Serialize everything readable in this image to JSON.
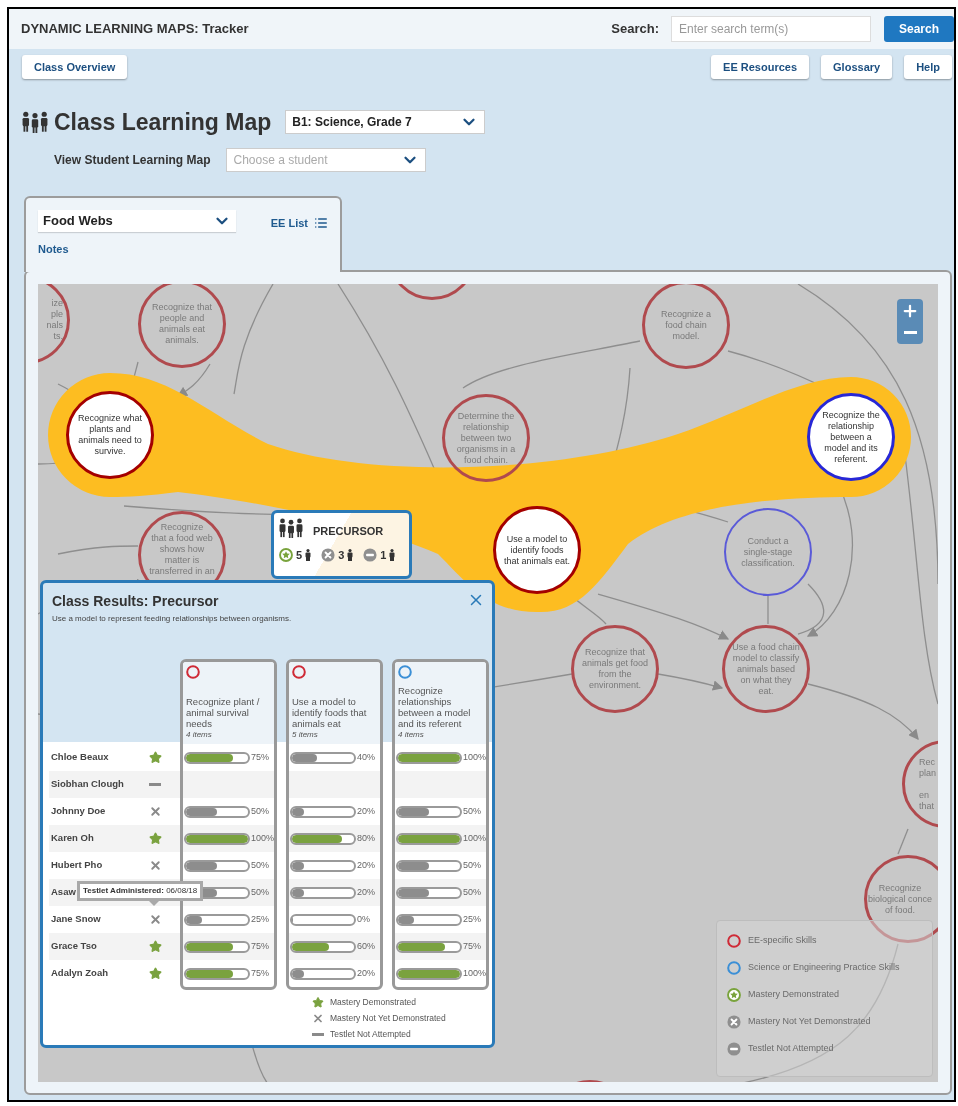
{
  "app": {
    "title": "DYNAMIC LEARNING MAPS: Tracker"
  },
  "search": {
    "label": "Search:",
    "placeholder": "Enter search term(s)",
    "button": "Search"
  },
  "nav_left": [
    "Class Overview"
  ],
  "nav_right": [
    "EE Resources",
    "Glossary",
    "Help"
  ],
  "page": {
    "title": "Class Learning Map",
    "class_select": "B1: Science, Grade 7",
    "student_label": "View Student Learning Map",
    "student_select": {
      "placeholder": "Choose a student"
    }
  },
  "map_tab": {
    "topic_select": "Food Webs",
    "ee_list": "EE List",
    "notes": "Notes"
  },
  "map": {
    "nodes": [
      {
        "kind": "ee",
        "highlighted": false
      },
      {
        "kind": "ee",
        "highlighted": false,
        "text": "ize\nple\nnals\nts."
      },
      {
        "kind": "ee",
        "highlighted": false,
        "text": "Recognize that people and animals eat animals."
      },
      {
        "kind": "ee",
        "highlighted": false,
        "text": "Recognize a food chain model."
      },
      {
        "kind": "ee",
        "highlighted": true,
        "text": "Recognize what plants and animals need to survive."
      },
      {
        "kind": "ee",
        "highlighted": false,
        "text": "Determine the relationship between two organisms in a food chain."
      },
      {
        "kind": "practice",
        "highlighted": true,
        "text": "Recognize the relationship between a model and its referent."
      },
      {
        "kind": "ee",
        "highlighted": false,
        "text": "Recognize\nthat a food web\nshows how\nmatter is\ntransferred in an"
      },
      {
        "kind": "ee",
        "highlighted": true,
        "text": "Use a model to identify foods that animals eat."
      },
      {
        "kind": "practice",
        "highlighted": false,
        "text": "Conduct a single-stage classification."
      },
      {
        "kind": "ee",
        "highlighted": false,
        "text": "Recognize that animals get food from the environment."
      },
      {
        "kind": "ee",
        "highlighted": false,
        "text": "Use a food chain model to classify animals based on what they eat."
      },
      {
        "kind": "ee",
        "highlighted": false,
        "text": "Rec\nplan\n\nen\nthat"
      },
      {
        "kind": "ee",
        "highlighted": false,
        "text": "Recognize\nbiological conce\nof food."
      },
      {
        "kind": "ee",
        "highlighted": false
      }
    ],
    "precursor": {
      "title": "PRECURSOR",
      "counts": [
        {
          "kind": "mastered",
          "count": "5"
        },
        {
          "kind": "not_yet",
          "count": "3"
        },
        {
          "kind": "not_attempted",
          "count": "1"
        }
      ]
    },
    "legend": [
      {
        "kind": "ee",
        "label": "EE-specific Skills"
      },
      {
        "kind": "practice",
        "label": "Science or Engineering Practice Skills"
      },
      {
        "kind": "mastered",
        "label": "Mastery Demonstrated"
      },
      {
        "kind": "not_yet",
        "label": "Mastery Not Yet Demonstrated"
      },
      {
        "kind": "not_attempted",
        "label": "Testlet Not Attempted"
      }
    ]
  },
  "results": {
    "title": "Class Results: Precursor",
    "subtitle": "Use a model to represent feeding relationships between organisms.",
    "columns": [
      {
        "kind": "ee",
        "title": "Recognize plant / animal survival needs",
        "items": "4 items"
      },
      {
        "kind": "ee",
        "title": "Use a model to identify foods that animals eat",
        "items": "5 items"
      },
      {
        "kind": "practice",
        "title": "Recognize relationships between a model and its referent",
        "items": "4 items"
      }
    ],
    "students": [
      {
        "name": "Chloe Beaux",
        "kind": "mastered",
        "scores": [
          {
            "level": 0.75,
            "reading": "75%",
            "mastered": true
          },
          {
            "level": 0.4,
            "reading": "40%",
            "mastered": false
          },
          {
            "level": 1,
            "reading": "100%",
            "mastered": true
          }
        ]
      },
      {
        "name": "Siobhan Clough",
        "kind": "not_attempted"
      },
      {
        "name": "Johnny Doe",
        "kind": "not_yet",
        "scores": [
          {
            "level": 0.5,
            "reading": "50%",
            "mastered": false
          },
          {
            "level": 0.2,
            "reading": "20%",
            "mastered": false
          },
          {
            "level": 0.5,
            "reading": "50%",
            "mastered": false
          }
        ]
      },
      {
        "name": "Karen Oh",
        "kind": "mastered",
        "scores": [
          {
            "level": 1,
            "reading": "100%",
            "mastered": true
          },
          {
            "level": 0.8,
            "reading": "80%",
            "mastered": true
          },
          {
            "level": 1,
            "reading": "100%",
            "mastered": true
          }
        ]
      },
      {
        "name": "Hubert Pho",
        "kind": "not_yet",
        "scores": [
          {
            "level": 0.5,
            "reading": "50%",
            "mastered": false
          },
          {
            "level": 0.2,
            "reading": "20%",
            "mastered": false
          },
          {
            "level": 0.5,
            "reading": "50%",
            "mastered": false
          }
        ]
      },
      {
        "name": "Asaw",
        "tooltip": "**Testlet Administered:** 06/08/18",
        "scores": [
          {
            "level": 0.5,
            "reading": "50%",
            "mastered": false
          },
          {
            "level": 0.2,
            "reading": "20%",
            "mastered": false
          },
          {
            "level": 0.5,
            "reading": "50%",
            "mastered": false
          }
        ]
      },
      {
        "name": "Jane Snow",
        "kind": "not_yet",
        "scores": [
          {
            "level": 0.25,
            "reading": "25%",
            "mastered": false
          },
          {
            "level": 0,
            "reading": "0%"
          },
          {
            "level": 0.25,
            "reading": "25%",
            "mastered": false
          }
        ]
      },
      {
        "name": "Grace Tso",
        "kind": "mastered",
        "scores": [
          {
            "level": 0.75,
            "reading": "75%",
            "mastered": true
          },
          {
            "level": 0.6,
            "reading": "60%",
            "mastered": true
          },
          {
            "level": 0.75,
            "reading": "75%",
            "mastered": true
          }
        ]
      },
      {
        "name": "Adalyn Zoah",
        "kind": "mastered",
        "scores": [
          {
            "level": 0.75,
            "reading": "75%",
            "mastered": true
          },
          {
            "level": 0.2,
            "reading": "20%",
            "mastered": false
          },
          {
            "level": 1,
            "reading": "100%",
            "mastered": true
          }
        ]
      }
    ],
    "legend": [
      {
        "kind": "mastered",
        "label": "Mastery Demonstrated"
      },
      {
        "kind": "not_yet",
        "label": "Mastery Not Yet Demonstrated"
      },
      {
        "kind": "not_attempted",
        "label": "Testlet Not Attempted"
      }
    ]
  }
}
